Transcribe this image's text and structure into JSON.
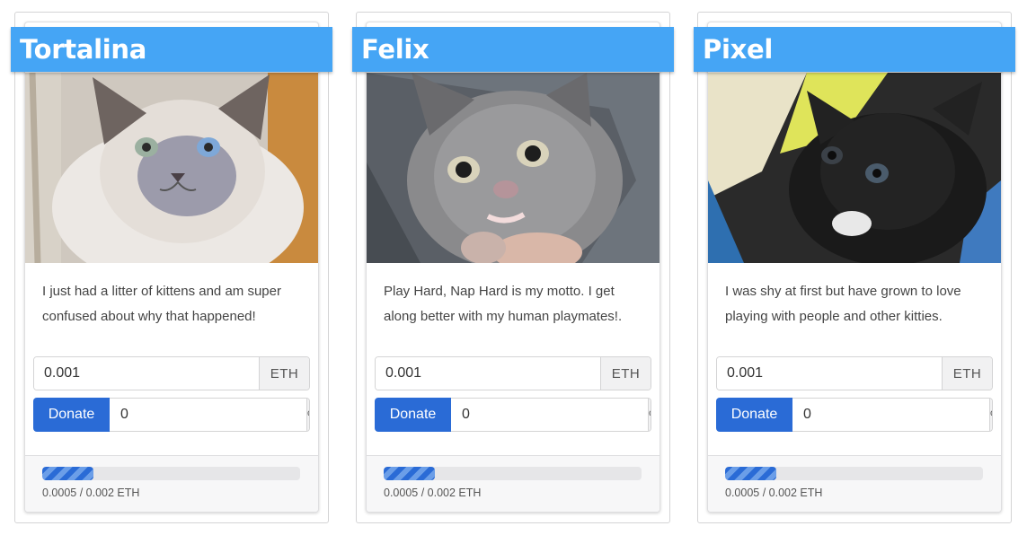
{
  "currency": "ETH",
  "percent_symbol": "%",
  "colors": {
    "ribbon": "#45a5f5",
    "button": "#2a6bd6",
    "progress": "#2a6bd6"
  },
  "cats": [
    {
      "name": "Tortalina",
      "description": "I just had a litter of kittens and am super confused about why that happened!",
      "amount": "0.001",
      "donate_label": "Donate",
      "percent_value": "0",
      "raised_text": "0.0005 / 0.002 ETH",
      "progress_fraction": 0.2
    },
    {
      "name": "Felix",
      "description": "Play Hard, Nap Hard is my motto. I get along better with my human playmates!.",
      "amount": "0.001",
      "donate_label": "Donate",
      "percent_value": "0",
      "raised_text": "0.0005 / 0.002 ETH",
      "progress_fraction": 0.2
    },
    {
      "name": "Pixel",
      "description": "I was shy at first but have grown to love playing with people and other kitties.",
      "amount": "0.001",
      "donate_label": "Donate",
      "percent_value": "0",
      "raised_text": "0.0005 / 0.002 ETH",
      "progress_fraction": 0.2
    }
  ]
}
